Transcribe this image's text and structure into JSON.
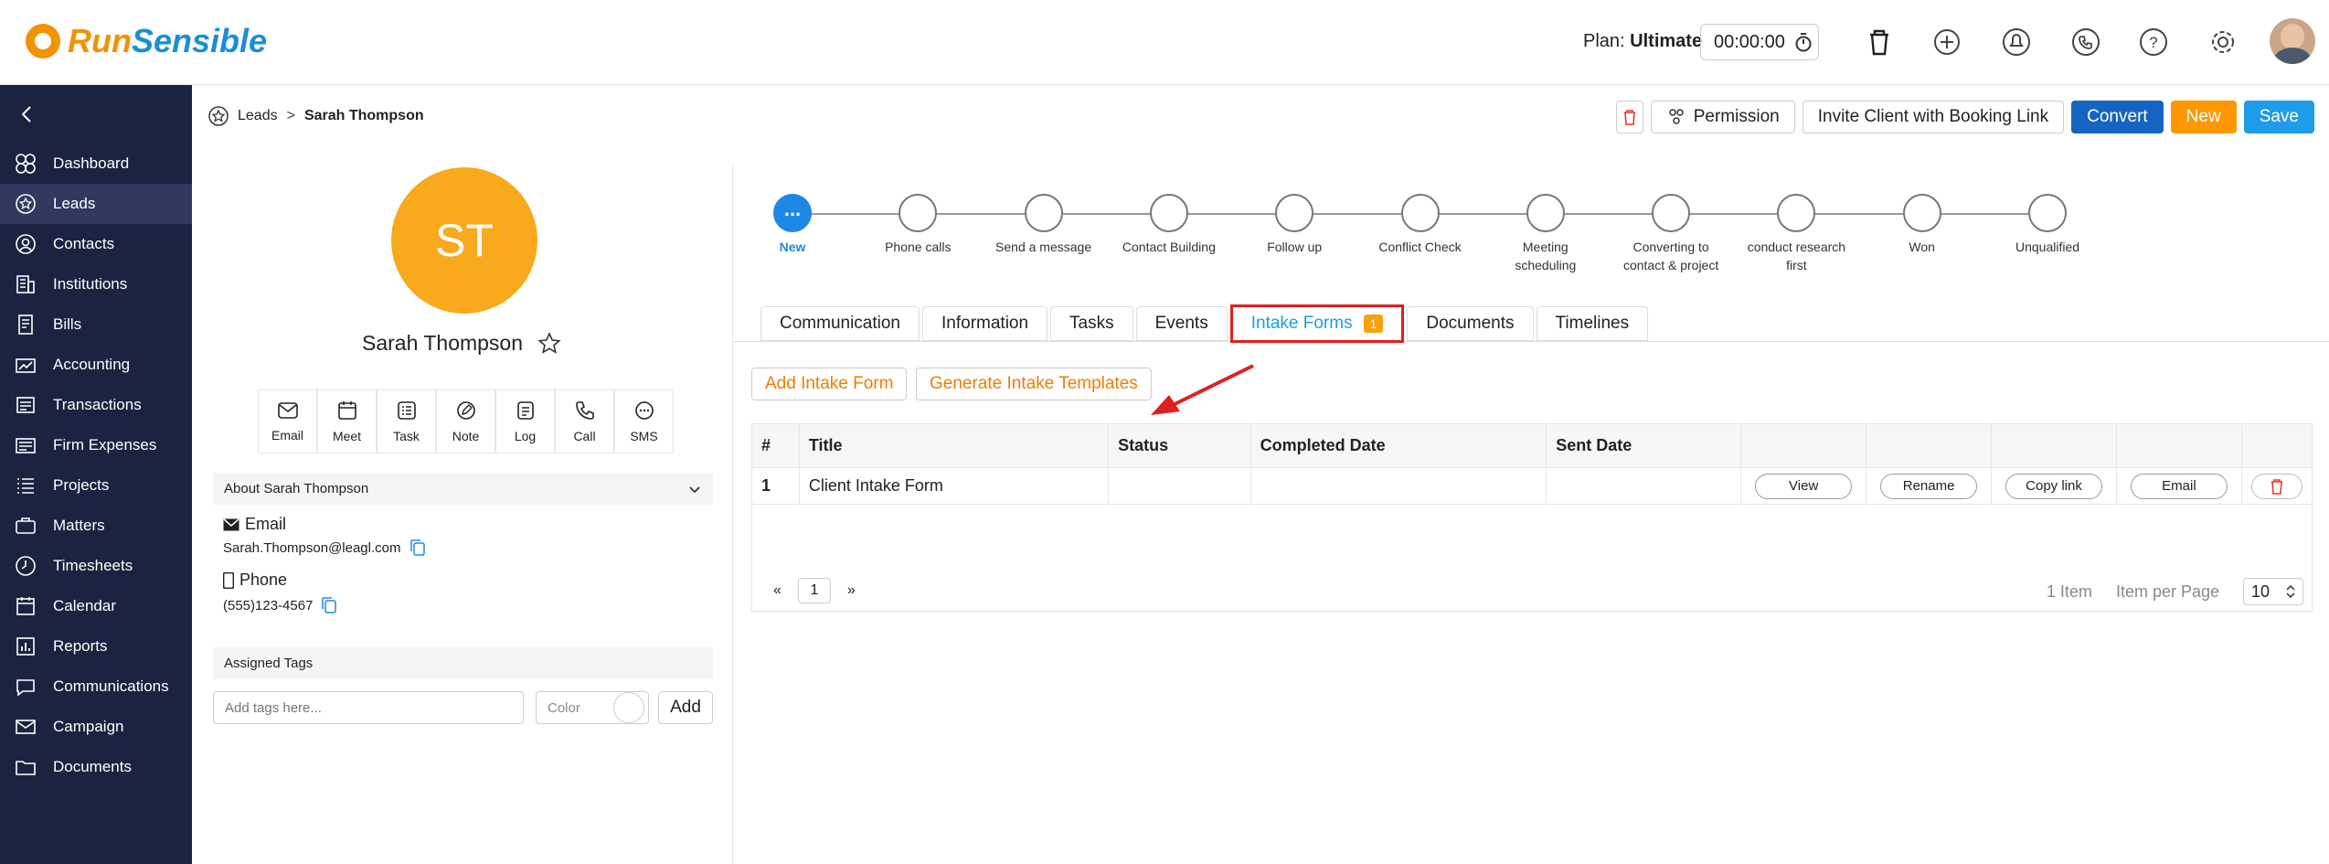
{
  "app": {
    "logo_run": "Run",
    "logo_sensible": "Sensible"
  },
  "topbar": {
    "plan_label": "Plan:",
    "plan_value": "Ultimate",
    "timer": "00:00:00"
  },
  "sidebar": {
    "items": [
      {
        "label": "Dashboard",
        "icon": "dashboard-icon"
      },
      {
        "label": "Leads",
        "icon": "leads-icon"
      },
      {
        "label": "Contacts",
        "icon": "contacts-icon"
      },
      {
        "label": "Institutions",
        "icon": "institutions-icon"
      },
      {
        "label": "Bills",
        "icon": "bills-icon"
      },
      {
        "label": "Accounting",
        "icon": "accounting-icon"
      },
      {
        "label": "Transactions",
        "icon": "transactions-icon"
      },
      {
        "label": "Firm Expenses",
        "icon": "firm-expenses-icon"
      },
      {
        "label": "Projects",
        "icon": "projects-icon"
      },
      {
        "label": "Matters",
        "icon": "matters-icon"
      },
      {
        "label": "Timesheets",
        "icon": "timesheets-icon"
      },
      {
        "label": "Calendar",
        "icon": "calendar-icon"
      },
      {
        "label": "Reports",
        "icon": "reports-icon"
      },
      {
        "label": "Communications",
        "icon": "communications-icon"
      },
      {
        "label": "Campaign",
        "icon": "campaign-icon"
      },
      {
        "label": "Documents",
        "icon": "documents-icon"
      }
    ],
    "active": "Leads"
  },
  "breadcrumb": {
    "root": "Leads",
    "sep": ">",
    "current": "Sarah Thompson"
  },
  "actions": {
    "permission": "Permission",
    "invite": "Invite Client with Booking Link",
    "convert": "Convert",
    "new": "New",
    "save": "Save"
  },
  "profile": {
    "initials": "ST",
    "name": "Sarah Thompson",
    "quick_actions": [
      "Email",
      "Meet",
      "Task",
      "Note",
      "Log",
      "Call",
      "SMS"
    ],
    "about_title": "About Sarah Thompson",
    "email_label": "Email",
    "email_value": "Sarah.Thompson@leagl.com",
    "phone_label": "Phone",
    "phone_value": "(555)123-4567",
    "tags_title": "Assigned Tags",
    "tags_placeholder": "Add tags here...",
    "color_label": "Color",
    "add_label": "Add"
  },
  "stages": {
    "current_glyph": "...",
    "items": [
      [
        "New"
      ],
      [
        "Phone calls"
      ],
      [
        "Send a message"
      ],
      [
        "Contact Building"
      ],
      [
        "Follow up"
      ],
      [
        "Conflict Check"
      ],
      [
        "Meeting",
        "scheduling"
      ],
      [
        "Converting to",
        "contact & project"
      ],
      [
        "conduct research",
        "first"
      ],
      [
        "Won"
      ],
      [
        "Unqualified"
      ]
    ]
  },
  "tabs": {
    "items": [
      "Communication",
      "Information",
      "Tasks",
      "Events",
      "Intake Forms",
      "Documents",
      "Timelines"
    ],
    "active": "Intake Forms",
    "intake_badge": "1"
  },
  "intake": {
    "add_button": "Add Intake Form",
    "generate_button": "Generate Intake Templates",
    "columns": [
      "#",
      "Title",
      "Status",
      "Completed Date",
      "Sent Date"
    ],
    "rows": [
      {
        "num": "1",
        "title": "Client Intake Form",
        "status": "",
        "completed": "",
        "sent": ""
      }
    ],
    "row_actions": [
      "View",
      "Rename",
      "Copy link",
      "Email"
    ],
    "pager_prev": "«",
    "pager_page": "1",
    "pager_next": "»",
    "total_items": "1 Item",
    "per_page_label": "Item per Page",
    "per_page_value": "10"
  },
  "colors": {
    "sidebar_bg": "#1c2340",
    "accent_orange": "#ff9800",
    "accent_blue": "#1e9be9",
    "convert_blue": "#1565c0",
    "highlight_red": "#e02020"
  }
}
